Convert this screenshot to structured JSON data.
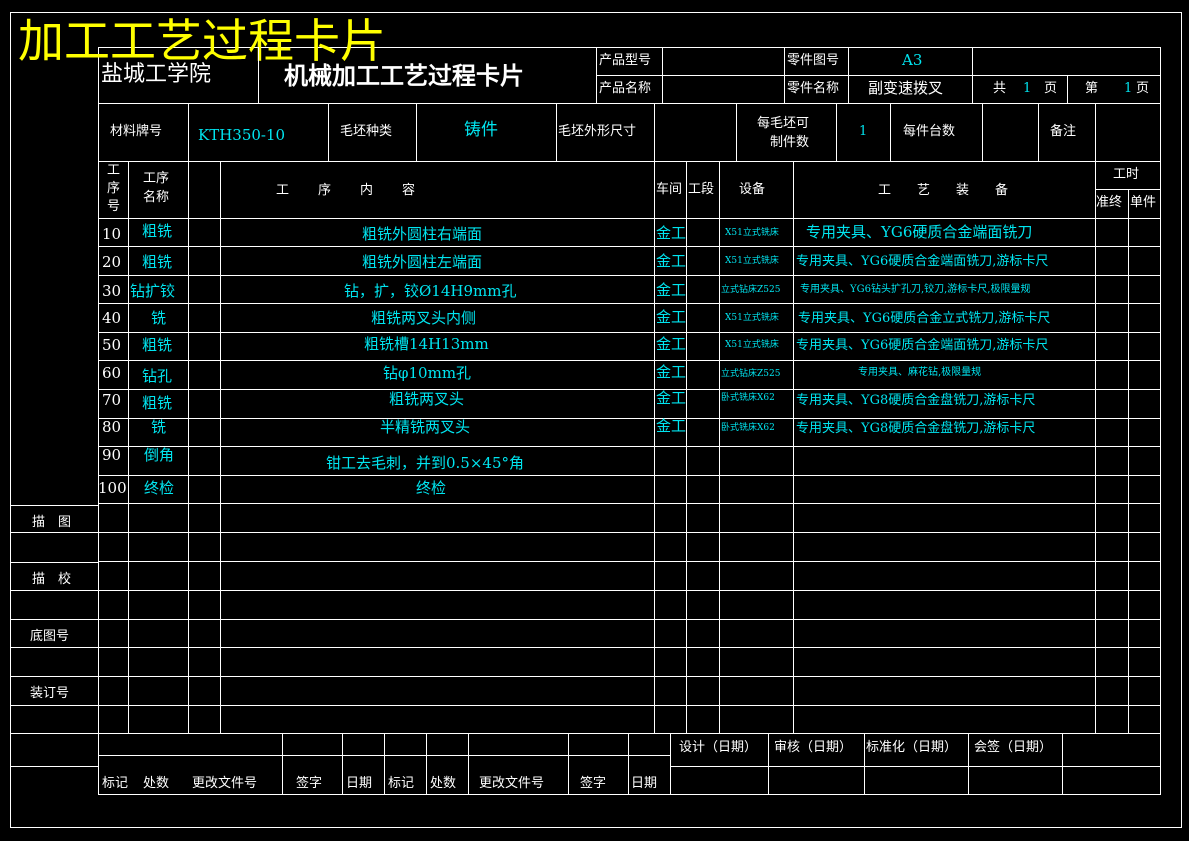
{
  "banner_title": "加工工艺过程卡片",
  "header": {
    "school": "盐城工学院",
    "card_title": "机械加工工艺过程卡片",
    "product_model_label": "产品型号",
    "product_model_value": "",
    "product_name_label": "产品名称",
    "product_name_value": "",
    "part_drawing_no_label": "零件图号",
    "part_drawing_no_value": "A3",
    "part_name_label": "零件名称",
    "part_name_value": "副变速拨叉",
    "total_label": "共",
    "total_pages": "1",
    "page_unit": "页",
    "page_label": "第",
    "page_no": "1",
    "page_unit2": "页"
  },
  "material": {
    "material_label": "材料牌号",
    "material_value": "KTH350-10",
    "blank_type_label": "毛坯种类",
    "blank_type_value": "铸件",
    "blank_size_label": "毛坯外形尺寸",
    "blank_size_value": "",
    "per_blank_label_1": "每毛坯可",
    "per_blank_label_2": "制件数",
    "per_blank_value": "1",
    "per_unit_label": "每件台数",
    "per_unit_value": "",
    "remark_label": "备注",
    "remark_value": ""
  },
  "columns": {
    "seq_1": "工",
    "seq_2": "序",
    "seq_3": "号",
    "name_1": "工序",
    "name_2": "名称",
    "content": "工　　序　　内　　容",
    "workshop": "车间",
    "section": "工段",
    "equipment": "设备",
    "tooling": "工　　艺　　装　　备",
    "hours": "工时",
    "prep": "准终",
    "unit": "单件"
  },
  "rows": [
    {
      "no": "10",
      "name": "粗铣",
      "content": "粗铣外圆柱右端面",
      "workshop": "金工",
      "equipment": "X51立式铣床",
      "tooling": "专用夹具、YG6硬质合金端面铣刀"
    },
    {
      "no": "20",
      "name": "粗铣",
      "content": "粗铣外圆柱左端面",
      "workshop": "金工",
      "equipment": "X51立式铣床",
      "tooling": "专用夹具、YG6硬质合金端面铣刀,游标卡尺"
    },
    {
      "no": "30",
      "name": "钻扩铰",
      "content": "钻，扩，铰Ø14H9mm孔",
      "workshop": "金工",
      "equipment": "立式钻床Z525",
      "tooling": "专用夹具、YG6钻头扩孔刀,铰刀,游标卡尺,极限量规"
    },
    {
      "no": "40",
      "name": "铣",
      "content": "粗铣两叉头内侧",
      "workshop": "金工",
      "equipment": "X51立式铣床",
      "tooling": "专用夹具、YG6硬质合金立式铣刀,游标卡尺"
    },
    {
      "no": "50",
      "name": "粗铣",
      "content": "粗铣槽14H13mm",
      "workshop": "金工",
      "equipment": "X51立式铣床",
      "tooling": "专用夹具、YG6硬质合金端面铣刀,游标卡尺"
    },
    {
      "no": "60",
      "name": "钻孔",
      "content": "钻φ10mm孔",
      "workshop": "金工",
      "equipment": "立式钻床Z525",
      "tooling": "专用夹具、麻花钻,极限量规"
    },
    {
      "no": "70",
      "name": "粗铣",
      "content": "粗铣两叉头",
      "workshop": "金工",
      "equipment": "卧式铣床X62",
      "tooling": "专用夹具、YG8硬质合金盘铣刀,游标卡尺"
    },
    {
      "no": "80",
      "name": "铣",
      "content": "半精铣两叉头",
      "workshop": "金工",
      "equipment": "卧式铣床X62",
      "tooling": "专用夹具、YG8硬质合金盘铣刀,游标卡尺"
    },
    {
      "no": "90",
      "name": "倒角",
      "content": "钳工去毛刺，并到0.5×45°角",
      "workshop": "",
      "equipment": "",
      "tooling": ""
    },
    {
      "no": "100",
      "name": "终检",
      "content": "终检",
      "workshop": "",
      "equipment": "",
      "tooling": ""
    }
  ],
  "side_labels": {
    "trace": "描　图",
    "check": "描　校",
    "base_drawing": "底图号",
    "binding": "装订号"
  },
  "footer": {
    "design": "设计（日期）",
    "review": "审核（日期）",
    "standard": "标准化（日期）",
    "countersign": "会签（日期）",
    "mark": "标记",
    "count": "处数",
    "change_doc": "更改文件号",
    "sign": "签字",
    "date": "日期",
    "mark2": "标记",
    "count2": "处数",
    "change_doc2": "更改文件号",
    "sign2": "签字",
    "date2": "日期"
  }
}
